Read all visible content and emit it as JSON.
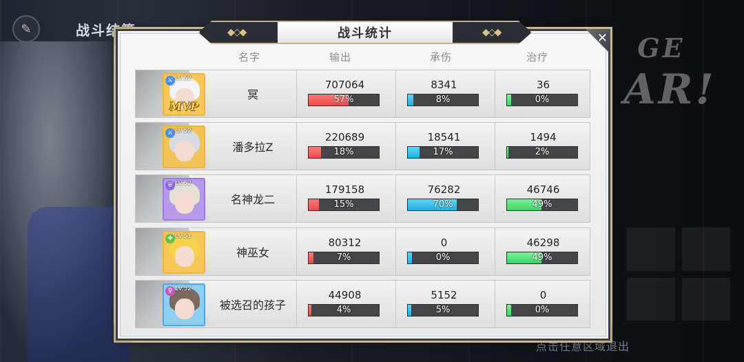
{
  "screen": {
    "title": "战斗结算",
    "exit_hint": "点击任意区域退出",
    "bg_text_1": "GE",
    "bg_text_2": "AR!"
  },
  "dialog": {
    "title": "战斗统计",
    "close": "✕",
    "headers": {
      "name": "名字",
      "damage": "输出",
      "taken": "承伤",
      "heal": "治疗"
    }
  },
  "rows": [
    {
      "name": "冥",
      "level": "Lv.52",
      "mvp": "MVP",
      "role_icon": "sword-icon",
      "damage": "707064",
      "damage_pct": "57%",
      "damage_fill": 0.57,
      "taken": "8341",
      "taken_pct": "8%",
      "taken_fill": 0.08,
      "heal": "36",
      "heal_pct": "0%",
      "heal_fill": 0.0,
      "frame": "#f0b63a",
      "hair": "#f4f4f7",
      "bg": "#f6c85a"
    },
    {
      "name": "潘多拉Z",
      "level": "Lv.52",
      "mvp": "",
      "role_icon": "sword-icon",
      "damage": "220689",
      "damage_pct": "18%",
      "damage_fill": 0.18,
      "taken": "18541",
      "taken_pct": "17%",
      "taken_fill": 0.17,
      "heal": "1494",
      "heal_pct": "2%",
      "heal_fill": 0.02,
      "frame": "#f0b63a",
      "hair": "#d9dbe2",
      "bg": "#f2c45a"
    },
    {
      "name": "名神龙二",
      "level": "Lv.52",
      "mvp": "",
      "role_icon": "shield-icon",
      "damage": "179158",
      "damage_pct": "15%",
      "damage_fill": 0.15,
      "taken": "76282",
      "taken_pct": "70%",
      "taken_fill": 0.7,
      "heal": "46746",
      "heal_pct": "49%",
      "heal_fill": 0.49,
      "frame": "#9a7be0",
      "hair": "#e3e0d6",
      "bg": "#b59bea"
    },
    {
      "name": "神巫女",
      "level": "Lv.51",
      "mvp": "",
      "role_icon": "cross-icon",
      "damage": "80312",
      "damage_pct": "7%",
      "damage_fill": 0.07,
      "taken": "0",
      "taken_pct": "0%",
      "taken_fill": 0.0,
      "heal": "46298",
      "heal_pct": "49%",
      "heal_fill": 0.49,
      "frame": "#f0b63a",
      "hair": "#f6d34a",
      "bg": "#f6c85a"
    },
    {
      "name": "被选召的孩子",
      "level": "Lv.52",
      "mvp": "",
      "role_icon": "female-icon",
      "damage": "44908",
      "damage_pct": "4%",
      "damage_fill": 0.04,
      "taken": "5152",
      "taken_pct": "5%",
      "taken_fill": 0.05,
      "heal": "0",
      "heal_pct": "0%",
      "heal_fill": 0.0,
      "frame": "#4fa6e8",
      "hair": "#7b6a60",
      "bg": "#8fd0f2"
    }
  ],
  "colors": {
    "damage": "#e54b4b",
    "taken": "#22aee0",
    "heal": "#3fd265",
    "gold": "#c6b27d"
  }
}
